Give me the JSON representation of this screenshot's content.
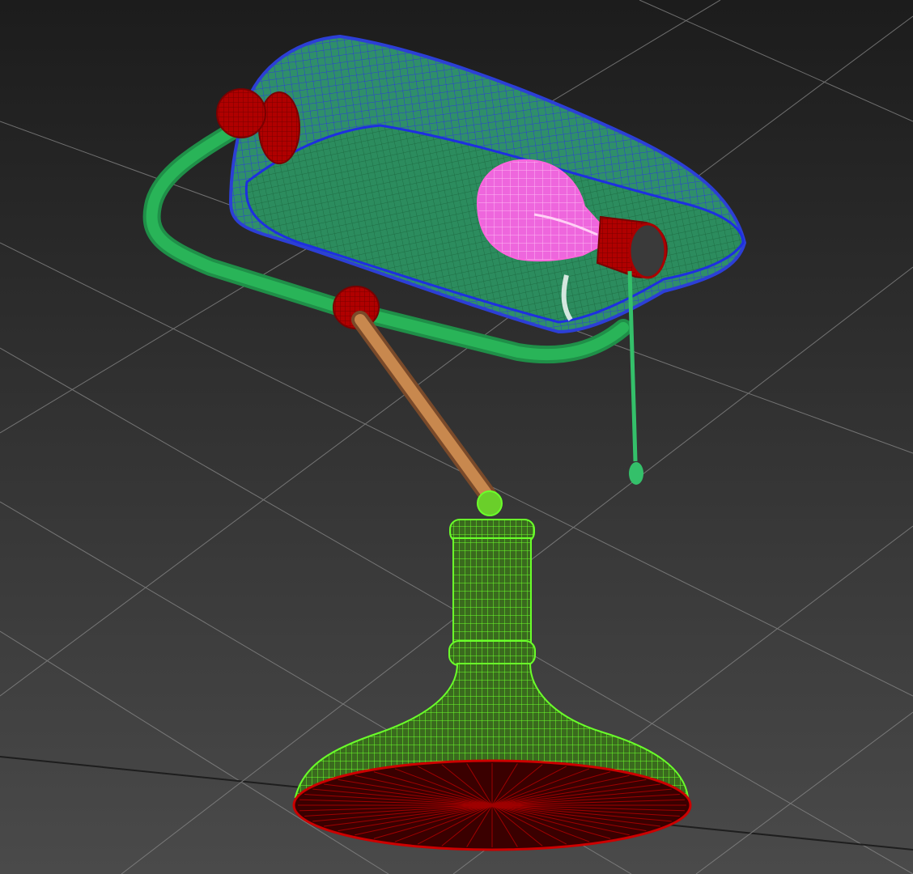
{
  "viewport": {
    "label": "",
    "active_border_color": "#c8a02a",
    "background_top": "#1c1c1c",
    "background_bottom": "#4a4a4a",
    "grid_color": "#8a8a8a"
  },
  "colors": {
    "shade_wire": "#2c3fd6",
    "shade_fill": "#2f8f6a",
    "arm_green": "#2ab85a",
    "joint_red": "#b40000",
    "rod_orange": "#c8884e",
    "bulb_pink": "#ff66dd",
    "socket_red": "#aa0000",
    "chain_green": "#34c06a",
    "base_wire": "#6aff2a",
    "base_bottom": "#8a0000"
  }
}
